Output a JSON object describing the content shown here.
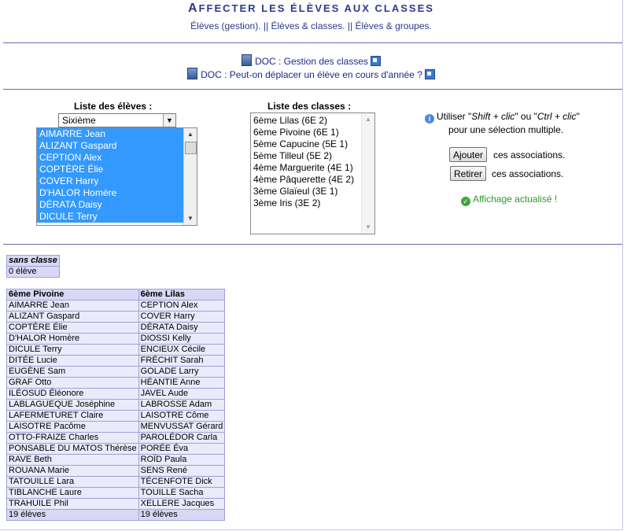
{
  "header": {
    "title_first": "A",
    "title_rest": "FFECTER LES ÉLÈVES AUX CLASSES",
    "nav": [
      "Élèves (gestion).",
      "Élèves & classes.",
      "Élèves & groupes."
    ],
    "nav_sep": "||"
  },
  "docs": [
    {
      "label": "DOC : Gestion des classes"
    },
    {
      "label": "DOC : Peut-on déplacer un élève en cours d'année ?"
    }
  ],
  "students_panel": {
    "label": "Liste des élèves :",
    "filter_value": "Sixième",
    "items": [
      "AIMARRE Jean",
      "ALIZANT Gaspard",
      "CEPTION Alex",
      "COPTÈRE Élie",
      "COVER Harry",
      "D'HALOR Homère",
      "DÉRATA Daisy",
      "DICULE Terry"
    ]
  },
  "classes_panel": {
    "label": "Liste des classes :",
    "items": [
      "6ème Lilas (6E 2)",
      "6ème Pivoine (6E 1)",
      "5ème Capucine (5E 1)",
      "5ème Tilleul (5E 2)",
      "4ème Marguerite (4E 1)",
      "4ème Pâquerette (4E 2)",
      "3ème Glaïeul (3E 1)",
      "3ème Iris (3E 2)"
    ]
  },
  "help": {
    "t1": "Utiliser \"",
    "shift": "Shift + clic",
    "t2": "\" ou \"",
    "ctrl": "Ctrl + clic",
    "t3": "\"",
    "line2": "pour une sélection multiple."
  },
  "actions": {
    "add_label": "Ajouter",
    "add_text": "ces associations.",
    "remove_label": "Retirer",
    "remove_text": "ces associations."
  },
  "status": {
    "text": "Affichage actualisé !",
    "color": "#2a9a2a"
  },
  "no_class": {
    "header": "sans classe",
    "count": "0 élève"
  },
  "class_tables": {
    "col1": {
      "header": "6ème Pivoine",
      "rows": [
        "AIMARRE Jean",
        "ALIZANT Gaspard",
        "COPTÈRE Élie",
        "D'HALOR Homère",
        "DICULE Terry",
        "DITÉE Lucie",
        "EUGÈNE Sam",
        "GRAF Otto",
        "ILÉOSUD Éléonore",
        "LABLAGUEQUE Joséphine",
        "LAFERMETURET Claire",
        "LAISOTRE Pacôme",
        "OTTO-FRAIZE Charles",
        "PONSABLE DU MATOS Thérèse",
        "RAVE Beth",
        "ROUANA Marie",
        "TATOUILLE Lara",
        "TIBLANCHE Laure",
        "TRAHUILE Phil"
      ],
      "count": "19 élèves"
    },
    "col2": {
      "header": "6ème Lilas",
      "rows": [
        "CEPTION Alex",
        "COVER Harry",
        "DÉRATA Daisy",
        "DIOSSI Kelly",
        "ENCIEUX Cécile",
        "FRÉCHIT Sarah",
        "GOLADE Larry",
        "HÉANTIE Anne",
        "JAVEL Aude",
        "LABROSSE Adam",
        "LAISOTRE Côme",
        "MENVUSSAT Gérard",
        "PAROLÉDOR Carla",
        "PORÉE Éva",
        "ROÏD Paula",
        "SENS René",
        "TÉCENFOTE Dick",
        "TOUILLE Sacha",
        "XELLERE Jacques"
      ],
      "count": "19 élèves"
    }
  }
}
